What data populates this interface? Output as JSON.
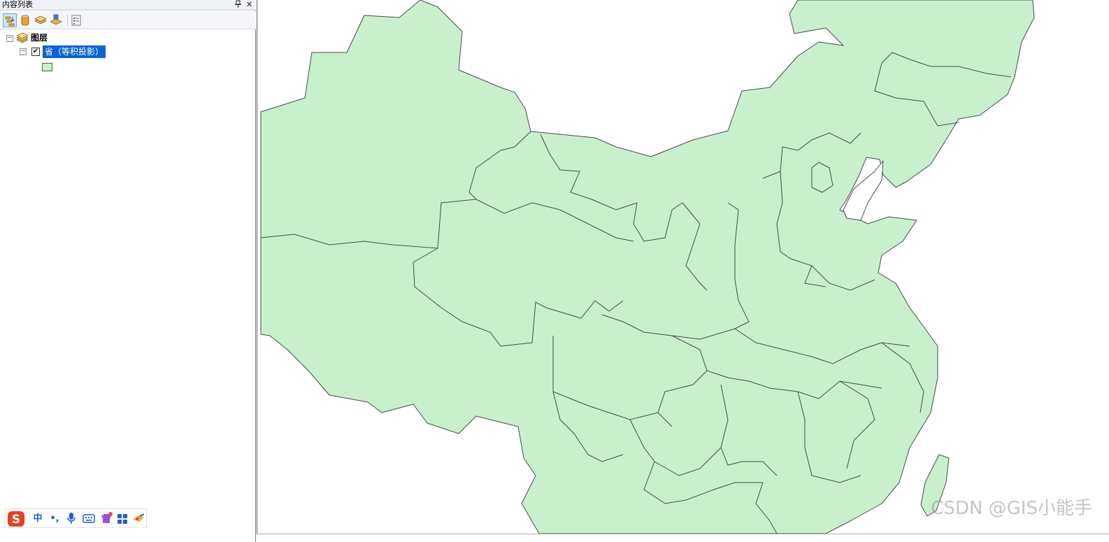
{
  "toc": {
    "title": "内容列表",
    "pin_glyph": "ꟷ",
    "close_glyph": "✕",
    "toolbar": {
      "tools": [
        {
          "name": "list-by-drawing-order-icon",
          "active": true
        },
        {
          "name": "list-by-source-icon",
          "active": false
        },
        {
          "name": "list-by-visibility-icon",
          "active": false
        },
        {
          "name": "list-by-selection-icon",
          "active": false
        },
        {
          "name": "options-icon",
          "active": false
        }
      ]
    },
    "tree": {
      "root_label": "图层",
      "root_expander": "−",
      "layer_expander": "−",
      "layer_checked": "✔",
      "layer_label": "省（等积投影）",
      "legend_color": "#c8f0cd"
    }
  },
  "ime": {
    "logo": "S",
    "mode": "中",
    "punct": "•,",
    "mic_icon": "mic-icon",
    "keyboard_icon": "keyboard-icon",
    "skin_icon": "skin-icon",
    "apps_icon": "apps-icon",
    "tools_icon": "tools-icon"
  },
  "map": {
    "fill_color": "#c8f0cd",
    "stroke_color": "#4a4a4a",
    "watermark": "CSDN @GIS小能手"
  }
}
